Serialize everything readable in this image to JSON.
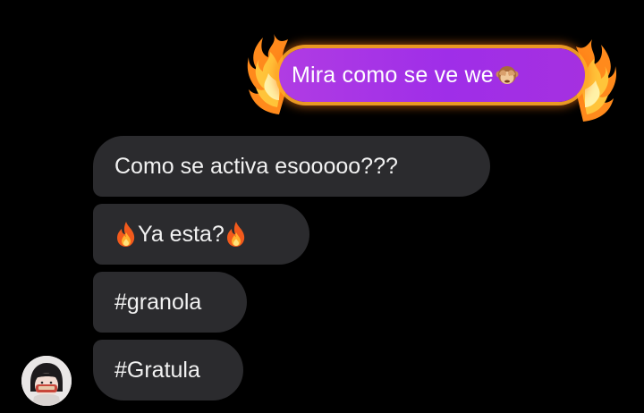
{
  "messages": {
    "sent": {
      "text": "Mira como se ve we",
      "emoji": "see-no-evil-monkey-icon",
      "bubble_color": "#a530e0",
      "effect": "fire"
    },
    "received": [
      {
        "text": "Como se activa esooooo???"
      },
      {
        "prefix_emoji": "fire-icon",
        "text": "Ya esta?",
        "suffix_emoji": "fire-icon"
      },
      {
        "text": "#granola"
      },
      {
        "text": "#Gratula"
      }
    ],
    "received_bubble_color": "#2b2b2e"
  },
  "avatar": {
    "icon": "avatar-icon"
  }
}
